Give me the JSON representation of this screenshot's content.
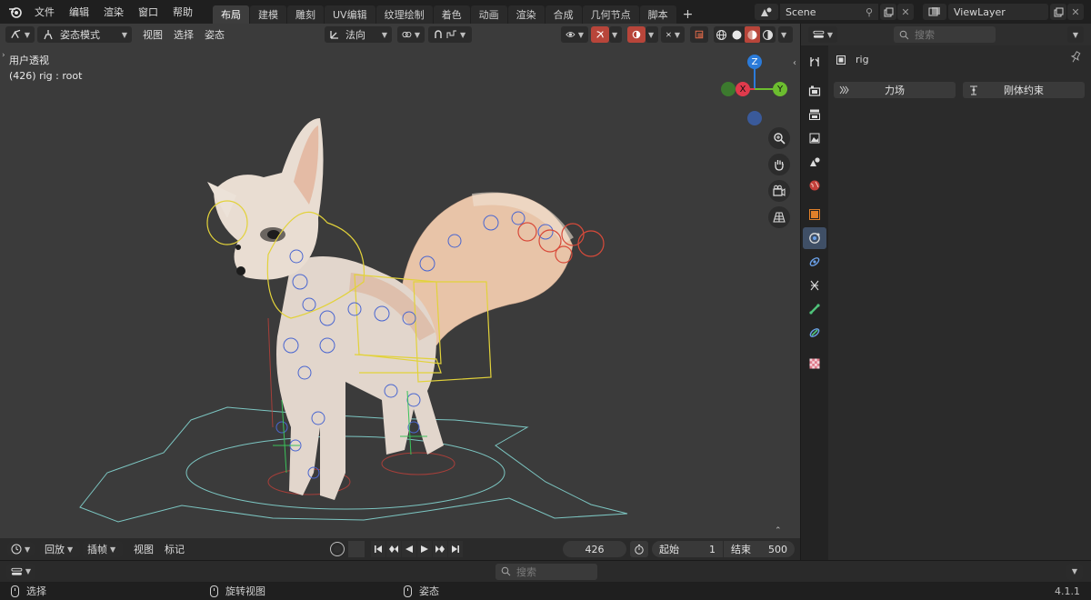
{
  "menu": {
    "items": [
      "文件",
      "编辑",
      "渲染",
      "窗口",
      "帮助"
    ]
  },
  "workspaces": [
    {
      "label": "布局",
      "active": true
    },
    {
      "label": "建模"
    },
    {
      "label": "雕刻"
    },
    {
      "label": "UV编辑"
    },
    {
      "label": "纹理绘制"
    },
    {
      "label": "着色"
    },
    {
      "label": "动画"
    },
    {
      "label": "渲染"
    },
    {
      "label": "合成"
    },
    {
      "label": "几何节点"
    },
    {
      "label": "脚本"
    }
  ],
  "scene": {
    "name": "Scene",
    "view_layer": "ViewLayer"
  },
  "viewport": {
    "mode": "姿态模式",
    "menus": [
      "视图",
      "选择",
      "姿态"
    ],
    "orientation": "法向",
    "info_line1": "用户透视",
    "info_line2": "(426) rig : root",
    "gizmo": {
      "x": "X",
      "y": "Y",
      "z": "Z"
    }
  },
  "timeline": {
    "menus": [
      "回放",
      "插帧",
      "视图",
      "标记"
    ],
    "current_frame": "426",
    "start_label": "起始",
    "start": "1",
    "end_label": "结束",
    "end": "500"
  },
  "properties": {
    "search_placeholder": "搜索",
    "object_name": "rig",
    "buttons": [
      "力场",
      "刚体约束"
    ]
  },
  "footer": {
    "search_placeholder": "搜索"
  },
  "status": {
    "select": "选择",
    "rotate": "旋转视图",
    "pose": "姿态",
    "version": "4.1.1"
  },
  "colors": {
    "accent": "#4a6ea8",
    "x_axis": "#e03a4c",
    "y_axis": "#6cbd2f",
    "z_axis": "#2b7bd9"
  }
}
